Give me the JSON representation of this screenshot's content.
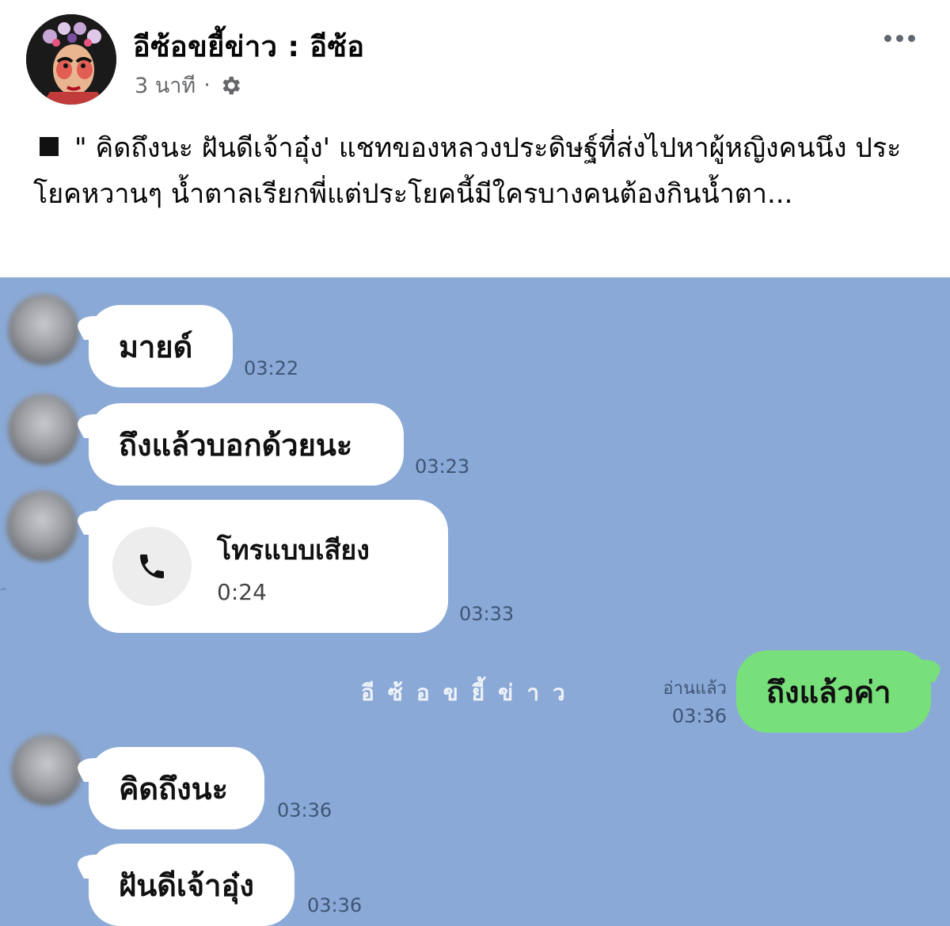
{
  "post": {
    "author": "อีซ้อขยี้ข่าว : อีซ้อ",
    "time": "3 นาที",
    "separator": "·",
    "privacy_icon": "gear-icon",
    "more_icon": "more-icon"
  },
  "caption": {
    "bullet_icon": "black-square",
    "text": "\" คิดถึงนะ ฝันดีเจ้าอุ๋ง' แชทของหลวงประดิษฐ์ที่ส่งไปหาผู้หญิงคนนึง ประโยคหวานๆ น้ำตาลเรียกพี่แต่ประโยคนี้มีใครบางคนต้องกินน้ำตา..."
  },
  "chat": {
    "background": "#8aa9d6",
    "messages": [
      {
        "text": "มายด์",
        "time": "03:22"
      },
      {
        "text": "ถึงแล้วบอกด้วยนะ",
        "time": "03:23"
      },
      {
        "type": "call",
        "title": "โทรแบบเสียง",
        "duration": "0:24",
        "time": "03:33",
        "icon": "phone-icon"
      },
      {
        "text": "ถึงแล้วค่า",
        "time": "03:36",
        "read_label": "อ่านแล้ว",
        "outgoing": true
      },
      {
        "text": "คิดถึงนะ",
        "time": "03:36"
      },
      {
        "text": "ฝันดีเจ้าอุ๋ง",
        "time": "03:36"
      }
    ],
    "watermark": "อีซ้อขยี้ข่าว",
    "outgoing_color": "#78e07a"
  }
}
